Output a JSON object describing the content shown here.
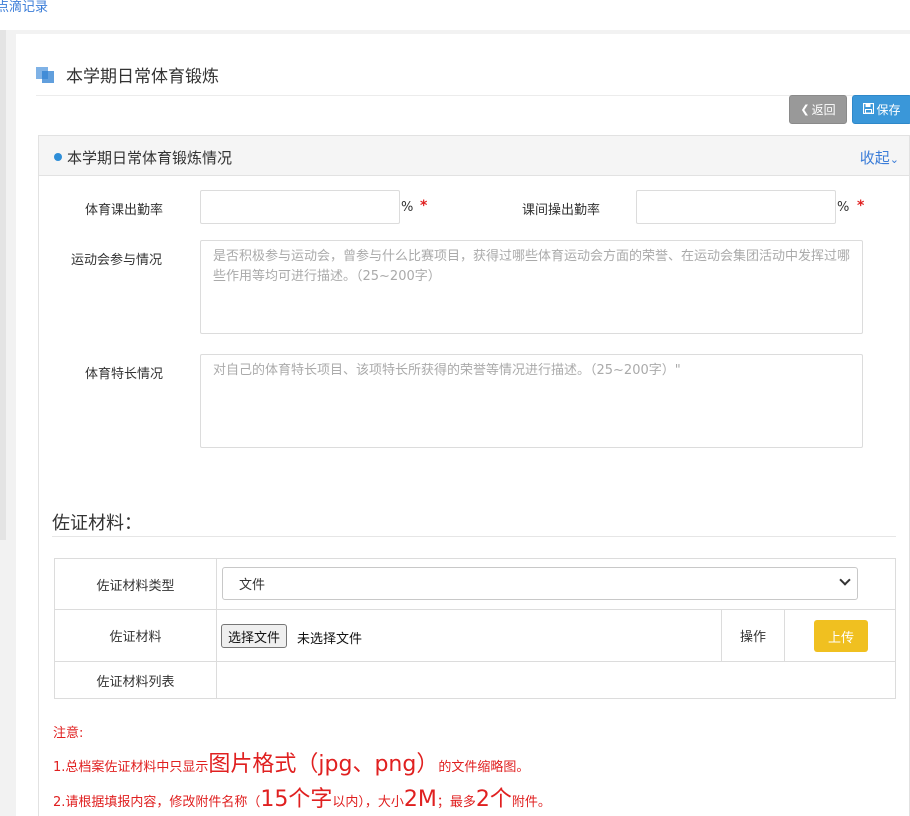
{
  "breadcrumb": {
    "last": "点滴记录"
  },
  "page": {
    "title": "本学期日常体育锻炼"
  },
  "toolbar": {
    "back_label": "返回",
    "save_label": "保存"
  },
  "panel": {
    "title": "本学期日常体育锻炼情况",
    "collapse_label": "收起"
  },
  "form": {
    "pe_attendance": {
      "label": "体育课出勤率",
      "value": "",
      "unit": "%",
      "required_mark": "*"
    },
    "exercise_attendance": {
      "label": "课间操出勤率",
      "value": "",
      "unit": "%",
      "required_mark": "*"
    },
    "sports_meet": {
      "label": "运动会参与情况",
      "placeholder": "是否积极参与运动会，曾参与什么比赛项目，获得过哪些体育运动会方面的荣誉、在运动会集团活动中发挥过哪些作用等均可进行描述。（25~200字）"
    },
    "sports_specialty": {
      "label": "体育特长情况",
      "placeholder": "对自己的体育特长项目、该项特长所获得的荣誉等情况进行描述。（25~200字）\""
    }
  },
  "evidence": {
    "section_title": "佐证材料：",
    "type_label": "佐证材料类型",
    "type_selected": "文件",
    "material_label": "佐证材料",
    "choose_file_label": "选择文件",
    "no_file_text": "未选择文件",
    "operation_label": "操作",
    "upload_label": "上传",
    "list_label": "佐证材料列表"
  },
  "notes": {
    "heading": "注意:",
    "line1_a": "1.总档案佐证材料中只显示",
    "line1_b": "图片格式（jpg、png）",
    "line1_c": "的文件缩略图。",
    "line2_a": "2.请根据填报内容，修改附件名称（",
    "line2_b": "15个字",
    "line2_c": "以内），大小",
    "line2_d": "2M",
    "line2_e": "；最多",
    "line2_f": "2个",
    "line2_g": "附件。"
  },
  "colors": {
    "accent": "#3a97d9",
    "back_button": "#999999",
    "upload_button": "#f0c020",
    "required": "#e02020",
    "link": "#3b7dd8"
  }
}
